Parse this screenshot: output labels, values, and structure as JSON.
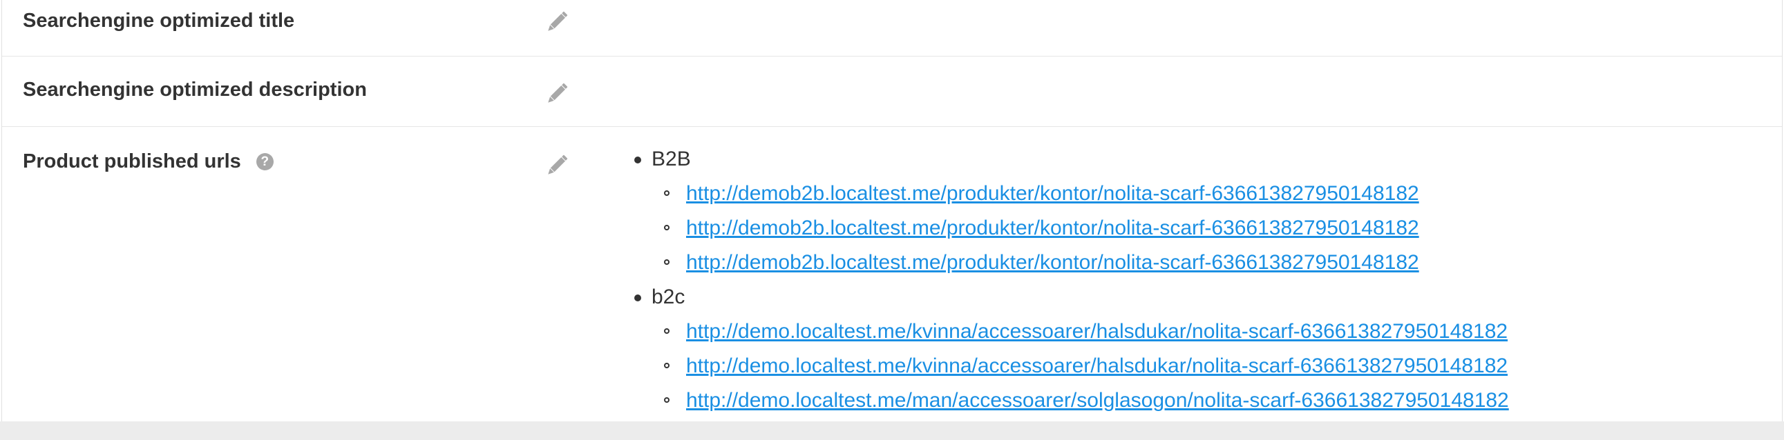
{
  "fields": {
    "seo_title": {
      "label": "Searchengine optimized title"
    },
    "seo_description": {
      "label": "Searchengine optimized description"
    },
    "published_urls": {
      "label": "Product published urls",
      "help_icon": "question-circle-icon",
      "groups": [
        {
          "name": "B2B",
          "urls": [
            "http://demob2b.localtest.me/produkter/kontor/nolita-scarf-636613827950148182",
            "http://demob2b.localtest.me/produkter/kontor/nolita-scarf-636613827950148182",
            "http://demob2b.localtest.me/produkter/kontor/nolita-scarf-636613827950148182"
          ]
        },
        {
          "name": "b2c",
          "urls": [
            "http://demo.localtest.me/kvinna/accessoarer/halsdukar/nolita-scarf-636613827950148182",
            "http://demo.localtest.me/kvinna/accessoarer/halsdukar/nolita-scarf-636613827950148182",
            "http://demo.localtest.me/man/accessoarer/solglasogon/nolita-scarf-636613827950148182"
          ]
        }
      ]
    }
  },
  "icons": {
    "edit": "pencil-icon",
    "help": "question-circle-icon"
  },
  "colors": {
    "link": "#1a8fe3",
    "label": "#333333",
    "icon": "#a8a8a8",
    "footer_bar": "#ececec"
  }
}
